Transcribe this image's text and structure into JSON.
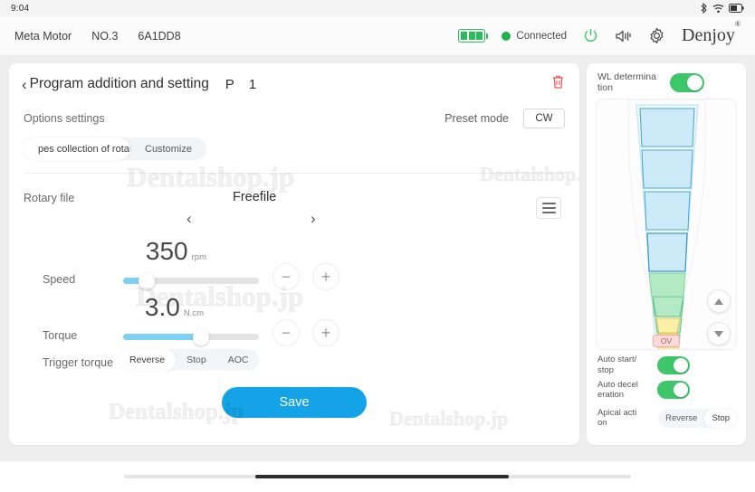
{
  "statusbar": {
    "clock": "9:04",
    "icons": [
      "bluetooth-icon",
      "wifi-icon",
      "battery-icon"
    ]
  },
  "appbar": {
    "device_name": "Meta Motor",
    "device_no": "NO.3",
    "device_id": "6A1DD8",
    "battery_icon": "battery-full-icon",
    "connection_status": "Connected",
    "connection_color": "#22b14c",
    "power_icon": "power-icon",
    "sound_icon": "speaker-icon",
    "settings_icon": "gear-icon",
    "brand": "Denjoy",
    "brand_mark": "®"
  },
  "card": {
    "back_icon": "chevron-left-icon",
    "title": "Program addition and setting",
    "program_label": "P",
    "program_number": "1",
    "delete_icon": "trash-icon",
    "options_label": "Options settings",
    "preset_mode_label": "Preset mode",
    "preset_mode_value": "CW",
    "options_tabs": [
      {
        "label": "pes collection of rotary f",
        "active": true
      },
      {
        "label": "Customize",
        "active": false
      }
    ],
    "rotary_file": {
      "label": "Rotary file",
      "value": "Freefile",
      "prev_icon": "chevron-left-icon",
      "next_icon": "chevron-right-icon",
      "list_icon": "list-menu-icon"
    },
    "speed": {
      "label": "Speed",
      "value": "350",
      "unit": "rpm",
      "slider_percent": 17,
      "minus_label": "−",
      "plus_label": "+"
    },
    "torque": {
      "label": "Torque",
      "value": "3.0",
      "unit": "N.cm",
      "slider_percent": 57,
      "minus_label": "−",
      "plus_label": "+"
    },
    "trigger_torque": {
      "label": "Trigger torque",
      "options": [
        {
          "label": "Reverse",
          "active": true
        },
        {
          "label": "Stop",
          "active": false
        },
        {
          "label": "AOC",
          "active": false
        }
      ]
    },
    "save_label": "Save",
    "save_color": "#13a3e6"
  },
  "right_panel": {
    "wl_label": "WL determina\ntion",
    "wl_enabled": true,
    "canal": {
      "ov_badge": "OV",
      "segment_colors": [
        "#cdeaf8",
        "#b4e9c6",
        "#fbf0a8"
      ],
      "up_icon": "triangle-up-icon",
      "down_icon": "triangle-down-icon"
    },
    "auto_start_stop": {
      "label": "Auto start/\nstop",
      "enabled": true
    },
    "auto_deceleration": {
      "label": "Auto decel\neration",
      "enabled": true
    },
    "apical_action": {
      "label": "Apical acti\non",
      "options": [
        {
          "label": "Reverse",
          "active": false
        },
        {
          "label": "Stop",
          "active": true
        }
      ]
    }
  },
  "watermarks": [
    "Dentalshop.jp",
    "Dentalshop.jp",
    "Dentalshop.jp",
    "Dentalshop.jp",
    "Dentalshop.jp"
  ]
}
